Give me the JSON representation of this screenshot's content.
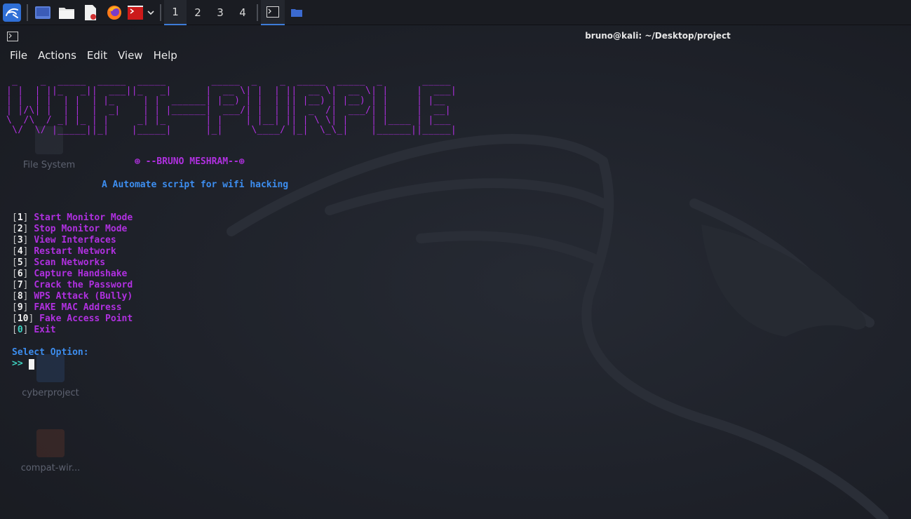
{
  "taskbar": {
    "workspaces": [
      "1",
      "2",
      "3",
      "4"
    ],
    "active_workspace": "1",
    "icons": [
      "kali-menu-icon",
      "show-desktop-icon",
      "file-manager-icon",
      "text-editor-icon",
      "firefox-icon",
      "terminal-emulator-icon",
      "dropdown-chevron-icon"
    ]
  },
  "desktop": {
    "icons": [
      {
        "label": "File System"
      },
      {
        "label": "cyberproject"
      },
      {
        "label": "compat-wir..."
      }
    ]
  },
  "window": {
    "title": "bruno@kali: ~/Desktop/project",
    "menu": [
      "File",
      "Actions",
      "Edit",
      "View",
      "Help"
    ]
  },
  "terminal": {
    "banner": " _    _  _____  _____  _____        _____  _    _  _____  _____  _       _____ \n| |  | ||_   _||  ___||_   _|      |  __ \\| |  | ||  __ \\|  __ \\| |     |  ___|\n| |  | |  | |  | |_     | |  ______| |__) | |  | || |__) | |__) | |     | |__  \n| |/\\| |  | |  |  _|    | | |______|  ___/| |  | ||  _  /|  ___/| |     |  __| \n\\  /\\  / _| |_ | |     _| |_       | |    | |__| || | \\ \\| |    | |____ | |___ \n \\/  \\/ |_____||_|    |_____|      |_|     \\____/ |_|  \\_\\_|    |______||_____|",
    "author": "⊕ --BRUNO MESHRAM--⊕",
    "tagline": "A Automate script for wifi hacking",
    "options": [
      {
        "num": "1",
        "label": "Start Monitor Mode"
      },
      {
        "num": "2",
        "label": "Stop Monitor Mode"
      },
      {
        "num": "3",
        "label": "View Interfaces"
      },
      {
        "num": "4",
        "label": "Restart Network"
      },
      {
        "num": "5",
        "label": "Scan Networks"
      },
      {
        "num": "6",
        "label": "Capture Handshake"
      },
      {
        "num": "7",
        "label": "Crack the Password"
      },
      {
        "num": "8",
        "label": "WPS Attack (Bully)"
      },
      {
        "num": "9",
        "label": "FAKE MAC Address"
      },
      {
        "num": "10",
        "label": "Fake Access Point"
      },
      {
        "num": "0",
        "label": "Exit"
      }
    ],
    "prompt_label": "Select Option:",
    "prompt_arrow": ">>"
  },
  "colors": {
    "accent_purple": "#b030e0",
    "accent_blue": "#3d8ef0",
    "accent_cyan": "#3fd0c0",
    "taskbar_active": "#3d7bd8"
  }
}
